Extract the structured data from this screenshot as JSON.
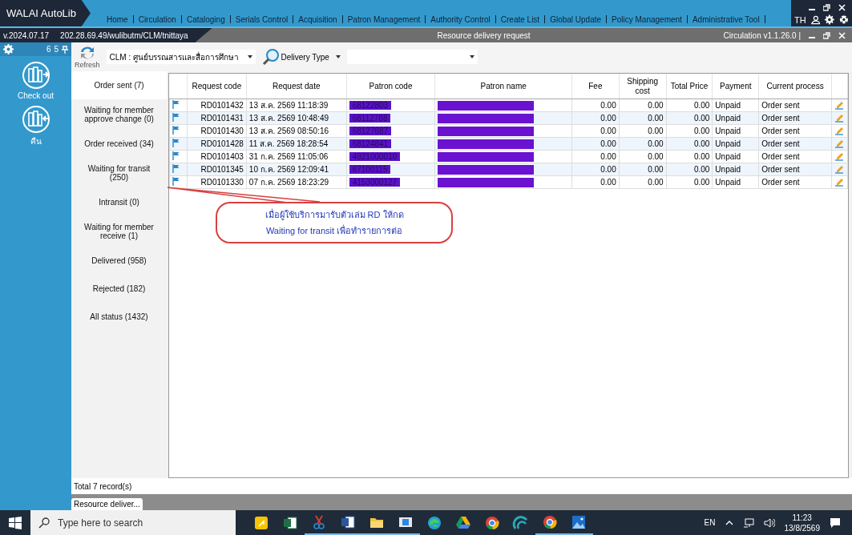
{
  "app": {
    "logo": "WALAI AutoLib",
    "menu": [
      "Home",
      "Circulation",
      "Cataloging",
      "Serials Control",
      "Acquisition",
      "Patron Management",
      "Authority Control",
      "Create List",
      "Global Update",
      "Policy Management",
      "Administrative Tool"
    ],
    "language": "TH"
  },
  "subbar": {
    "version": "v.2024.07.17",
    "path": "202.28.69.49/wulibutm/CLM/tnittaya",
    "title": "Resource delivery request",
    "module": "Circulation v1.1.26.0 |"
  },
  "side_panel": {
    "counts": [
      "6",
      "5"
    ],
    "actions": [
      {
        "label": "Check out",
        "kind": "checkout"
      },
      {
        "label": "คืน",
        "kind": "return"
      }
    ]
  },
  "toolbar": {
    "refresh": "Refresh",
    "library": "CLM : ศูนย์บรรณสารและสื่อการศึกษา",
    "delivery_type_label": "Delivery Type"
  },
  "status_tabs": [
    {
      "label": "Order sent (7)",
      "selected": true
    },
    {
      "label": "Waiting for member approve change (0)",
      "selected": false
    },
    {
      "label": "Order received (34)",
      "selected": false
    },
    {
      "label": "Waiting for transit (250)",
      "selected": false
    },
    {
      "label": "Intransit (0)",
      "selected": false
    },
    {
      "label": "Waiting for member receive (1)",
      "selected": false
    },
    {
      "label": "Delivered (958)",
      "selected": false
    },
    {
      "label": "Rejected (182)",
      "selected": false
    },
    {
      "label": "All status (1432)",
      "selected": false
    }
  ],
  "table": {
    "columns": [
      "Request code",
      "Request date",
      "Patron code",
      "Patron name",
      "Fee",
      "Shipping cost",
      "Total Price",
      "Payment",
      "Current process"
    ],
    "rows": [
      {
        "request_code": "RD0101432",
        "request_date": "13 ส.ค. 2569 11:18:39",
        "patron_code": "68122803",
        "patron_name_redacted": true,
        "fee": "0.00",
        "shipping_cost": "0.00",
        "total_price": "0.00",
        "payment": "Unpaid",
        "current_process": "Order sent"
      },
      {
        "request_code": "RD0101431",
        "request_date": "13 ส.ค. 2569 10:48:49",
        "patron_code": "68112788",
        "patron_name_redacted": true,
        "fee": "0.00",
        "shipping_cost": "0.00",
        "total_price": "0.00",
        "payment": "Unpaid",
        "current_process": "Order sent"
      },
      {
        "request_code": "RD0101430",
        "request_date": "13 ส.ค. 2569 08:50:16",
        "patron_code": "68127687",
        "patron_name_redacted": true,
        "fee": "0.00",
        "shipping_cost": "0.00",
        "total_price": "0.00",
        "payment": "Unpaid",
        "current_process": "Order sent"
      },
      {
        "request_code": "RD0101428",
        "request_date": "11 ส.ค. 2569 18:28:54",
        "patron_code": "68124841",
        "patron_name_redacted": true,
        "fee": "0.00",
        "shipping_cost": "0.00",
        "total_price": "0.00",
        "payment": "Unpaid",
        "current_process": "Order sent"
      },
      {
        "request_code": "RD0101403",
        "request_date": "31 ก.ค. 2569 11:05:06",
        "patron_code": "4921000010",
        "patron_name_redacted": true,
        "fee": "0.00",
        "shipping_cost": "0.00",
        "total_price": "0.00",
        "payment": "Unpaid",
        "current_process": "Order sent"
      },
      {
        "request_code": "RD0101345",
        "request_date": "10 ก.ค. 2569 12:09:41",
        "patron_code": "67100115",
        "patron_name_redacted": true,
        "fee": "0.00",
        "shipping_cost": "0.00",
        "total_price": "0.00",
        "payment": "Unpaid",
        "current_process": "Order sent"
      },
      {
        "request_code": "RD0101330",
        "request_date": "07 ก.ค. 2569 18:23:29",
        "patron_code": "4153000127",
        "patron_name_redacted": true,
        "fee": "0.00",
        "shipping_cost": "0.00",
        "total_price": "0.00",
        "payment": "Unpaid",
        "current_process": "Order sent"
      }
    ]
  },
  "total": "Total 7 record(s)",
  "window_tabs": [
    {
      "label": "Resource deliver...",
      "selected": true
    }
  ],
  "annotation": {
    "text": "เมื่อผู้ใช้บริการมารับตัวเล่ม RD ให้กด Waiting for transit เพื่อทำรายการต่อ"
  },
  "taskbar": {
    "search_placeholder": "Type here to search",
    "apps": [
      {
        "kind": "notes",
        "running": false
      },
      {
        "kind": "excel",
        "running": false
      },
      {
        "kind": "snip",
        "running": true
      },
      {
        "kind": "word",
        "running": true
      },
      {
        "kind": "folder",
        "running": true
      },
      {
        "kind": "window",
        "running": true
      },
      {
        "kind": "edge",
        "running": false
      },
      {
        "kind": "drive",
        "running": false
      },
      {
        "kind": "chrome",
        "running": false
      },
      {
        "kind": "wave",
        "running": false
      },
      {
        "kind": "chrome",
        "running": true
      },
      {
        "kind": "photos",
        "running": true
      }
    ],
    "language": "EN",
    "time": "11:23",
    "date": "13/8/2569"
  }
}
